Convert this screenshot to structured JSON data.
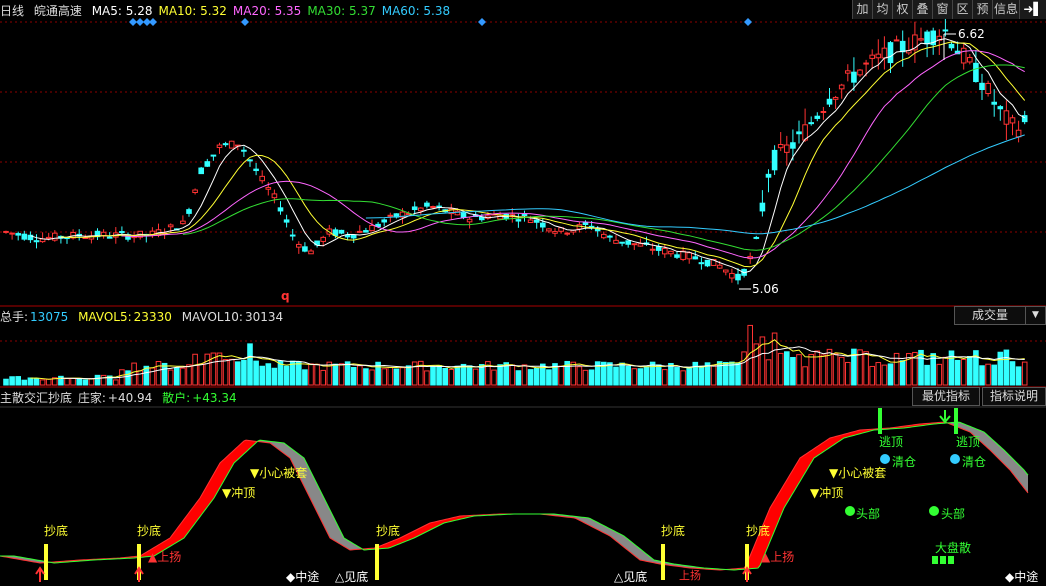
{
  "price": {
    "period": "日线",
    "stock": "皖通高速",
    "ma": [
      {
        "label": "MA5:",
        "value": "5.28",
        "color": "#ffffff"
      },
      {
        "label": "MA10:",
        "value": "5.32",
        "color": "#ffff33"
      },
      {
        "label": "MA20:",
        "value": "5.35",
        "color": "#ff66ff"
      },
      {
        "label": "MA30:",
        "value": "5.37",
        "color": "#33dd33"
      },
      {
        "label": "MA60:",
        "value": "5.38",
        "color": "#33ccff"
      }
    ],
    "high_label": "6.62",
    "low_label": "5.06",
    "q_mark": "q"
  },
  "toolbar": [
    "加",
    "均",
    "权",
    "叠",
    "窗",
    "区",
    "预",
    "信息",
    "➜▌"
  ],
  "volume": {
    "label": "总手:",
    "value": "13075",
    "mavol5_label": "MAVOL5:",
    "mavol5": "23330",
    "mavol10_label": "MAVOL10:",
    "mavol10": "30134",
    "selector": "成交量"
  },
  "indicator": {
    "name": "主散交汇抄底",
    "main_label": "庄家:",
    "main_value": "+40.94",
    "retail_label": "散户:",
    "retail_value": "+43.34",
    "btn_best": "最优指标",
    "btn_help": "指标说明",
    "signals": {
      "chaodi": "抄底",
      "shangyang": "▲上扬",
      "shangyang2": "上扬",
      "xiaoxin": "▼小心被套",
      "xiaoxin_a": "▼小心被套",
      "chongding": "▼冲顶",
      "taoding": "逃顶",
      "qingcang": "清仓",
      "toubu": "头部",
      "dapansan": "大盘散",
      "zhongtu": "◆中途",
      "jiandi": "△见底",
      "jiandi2": "△见底"
    }
  },
  "colors": {
    "up": "#ff3333",
    "down": "#33ffff",
    "grid": "#8b0000",
    "main": "#ff0000",
    "retail": "#888888"
  }
}
